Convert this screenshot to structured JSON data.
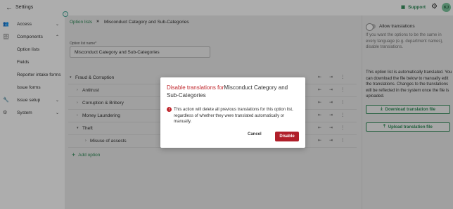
{
  "header": {
    "title": "Settings",
    "support_label": "Support",
    "avatar_initials": "KJ"
  },
  "sidebar": {
    "access": "Access",
    "components": "Components",
    "sub_items": [
      "Option lists",
      "Fields",
      "Reporter intake forms",
      "Issue forms"
    ],
    "issue_setup": "Issue setup",
    "system": "System"
  },
  "main": {
    "breadcrumb": [
      "Option lists",
      "Misconduct Category and Sub-Categories"
    ],
    "field_label": "Option list name*",
    "field_value": "Misconduct Category and Sub-Categories",
    "tree": [
      {
        "label": "Fraud & Corruption",
        "level": 0,
        "toggle": "▾"
      },
      {
        "label": "Antitrust",
        "level": 1,
        "toggle": "›"
      },
      {
        "label": "Corruption & Bribery",
        "level": 1,
        "toggle": "›"
      },
      {
        "label": "Money Laundering",
        "level": 1,
        "toggle": "›"
      },
      {
        "label": "Theft",
        "level": 1,
        "toggle": "▾"
      },
      {
        "label": "Misuse of assests",
        "level": 2,
        "toggle": "›"
      }
    ],
    "add_option": "Add option"
  },
  "right_panel": {
    "toggle_label": "Allow translations",
    "hint": "If you want the options to be the same in every language (e.g. department names), disable translations.",
    "info": "This option list is automatically translated. You can download the file below to manually edit the translations. Changes to the translations will be reflected in the system once the file is uploaded.",
    "download_label": "Download translation file",
    "upload_label": "Upload translation file"
  },
  "modal": {
    "title_prefix": "Disable translations for",
    "title_name": "Misconduct Category and Sub-Categories",
    "body": "This action will delete all previous translations for this option list, regardless of whether they were translated automatically or manually.",
    "cancel_label": "Cancel",
    "disable_label": "Disable"
  },
  "colors": {
    "accent": "#2e8b57",
    "danger": "#b01f2a"
  }
}
